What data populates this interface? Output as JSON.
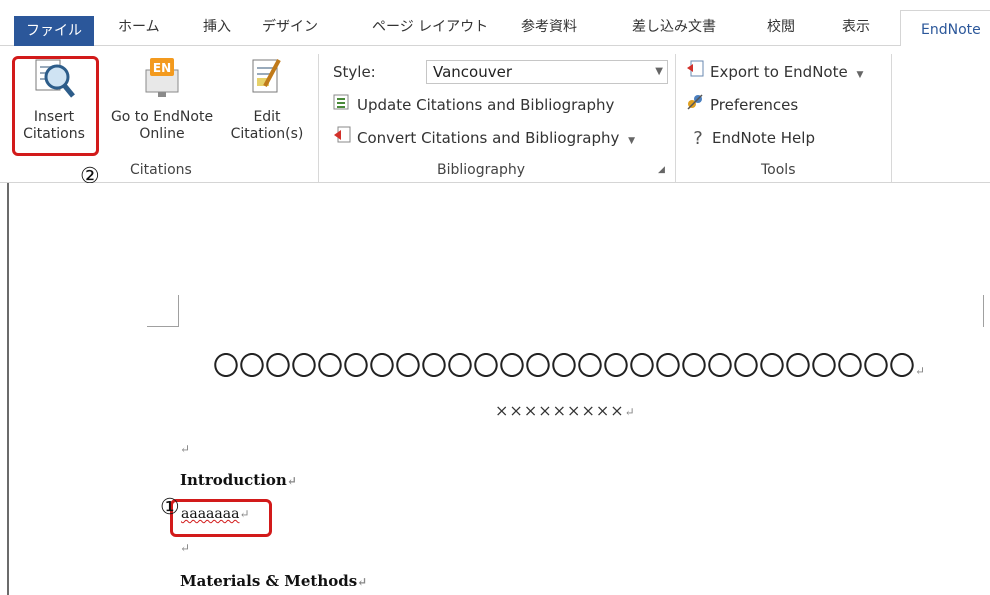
{
  "tabs": {
    "file": "ファイル",
    "home": "ホーム",
    "insert": "挿入",
    "design": "デザイン",
    "layout": "ページ レイアウト",
    "references": "参考資料",
    "mailings": "差し込み文書",
    "review": "校閲",
    "view": "表示",
    "endnote": "EndNote"
  },
  "ribbon": {
    "citations": {
      "insert_line1": "Insert",
      "insert_line2": "Citations",
      "goto_line1": "Go to EndNote",
      "goto_line2": "Online",
      "edit_line1": "Edit",
      "edit_line2": "Citation(s)",
      "group_label": "Citations"
    },
    "bibliography": {
      "style_label": "Style:",
      "style_value": "Vancouver",
      "update": "Update Citations and Bibliography",
      "convert": "Convert Citations and Bibliography",
      "group_label": "Bibliography"
    },
    "tools": {
      "export": "Export to EndNote",
      "preferences": "Preferences",
      "help_glyph": "?",
      "help": "EndNote Help",
      "group_label": "Tools"
    }
  },
  "document": {
    "title": "〇〇〇〇〇〇〇〇〇〇〇〇〇〇〇〇〇〇〇〇〇〇〇〇〇〇〇",
    "authors": "×××××××××",
    "introduction": "Introduction",
    "body_text": "aaaaaaa",
    "methods": "Materials & Methods"
  },
  "annotations": {
    "marker_1": "①",
    "marker_2": "②"
  },
  "colors": {
    "file_tab": "#2b579a",
    "highlight": "#d21a1a"
  }
}
